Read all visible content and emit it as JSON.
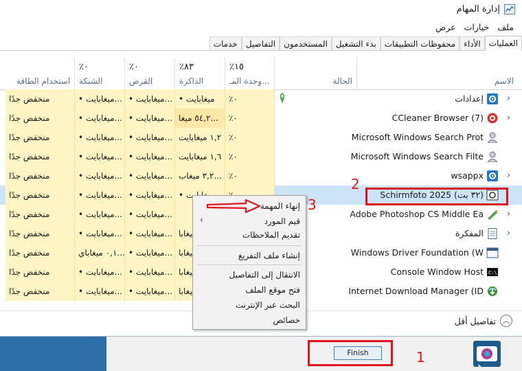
{
  "window": {
    "title": "إدارة المهام",
    "menu": [
      "ملف",
      "خيارات",
      "عرض"
    ],
    "tabs": [
      "العمليات",
      "الأداء",
      "محفوظات التطبيقات",
      "بدء التشغيل",
      "المستخدمون",
      "التفاصيل",
      "خدمات"
    ],
    "active_tab": "العمليات"
  },
  "columns": {
    "name": {
      "label": "الاسم"
    },
    "status": {
      "label": "الحالة"
    },
    "cpu": {
      "pct": "٪١٥",
      "label": "وحدة المـ..."
    },
    "memory": {
      "pct": "٪٨٣",
      "label": "الذاكرة"
    },
    "disk": {
      "pct": "٪٠",
      "label": "القرص"
    },
    "network": {
      "pct": "٪٠",
      "label": "الشبكة"
    },
    "power": {
      "label": "استخدام الطاقة"
    }
  },
  "processes": [
    {
      "name": "إعدادات",
      "icon": "gear-icon",
      "expand": true,
      "status_icon": true,
      "cpu": "٪٠",
      "memory": "• ميغابايت",
      "disk": "• ميغابايت...",
      "network": "• ميغابايت...",
      "power": "منخفض جدًا"
    },
    {
      "name": "CCleaner Browser (7)",
      "icon": "ccleaner-icon",
      "expand": true,
      "cpu": "٪٠",
      "memory": "٥٤,٢ ميغا...",
      "disk": "• ميغابايت...",
      "network": "• ميغابايت...",
      "power": "منخفض جدًا"
    },
    {
      "name": "Microsoft Windows Search Prot",
      "icon": "search-user-icon",
      "expand": false,
      "cpu": "٪٠",
      "memory": "١,٢ ميغابايت",
      "disk": "• ميغابايت...",
      "network": "• ميغابايت...",
      "power": "منخفض جدًا"
    },
    {
      "name": "Microsoft Windows Search Filte",
      "icon": "search-user-icon",
      "expand": false,
      "cpu": "٪٠",
      "memory": "١,٦ ميغابايت",
      "disk": "• ميغابايت...",
      "network": "• ميغابايت...",
      "power": "منخفض جدًا"
    },
    {
      "name": "wsappx",
      "icon": "gear-icon",
      "expand": true,
      "cpu": "٪٠",
      "memory": "٣,٢ ميغاب...",
      "disk": "• ميغابايت...",
      "network": "• ميغابايت...",
      "power": "منخفض جدًا"
    },
    {
      "name": "Schirmfoto 2025 (٣٢ بت)",
      "icon": "camera-icon",
      "expand": false,
      "selected": true,
      "cpu": "٪٠",
      "memory": "• ميغابايت",
      "disk": "• ميغابايت...",
      "network": "• ميغابايت...",
      "power": "منخفض جدًا"
    },
    {
      "name": "Adobe Photoshop CS Middle Ea",
      "icon": "photoshop-icon",
      "expand": true,
      "cpu": "",
      "memory": "",
      "disk": "• ميغابايت...",
      "network": "• ميغابايت...",
      "power": "منخفض جدًا"
    },
    {
      "name": "المفكرة",
      "icon": "notepad-icon",
      "expand": true,
      "cpu": "",
      "memory": "١,٢ ميغابا...",
      "disk": "• ميغابايت...",
      "network": "• ميغابايت...",
      "power": "منخفض جدًا"
    },
    {
      "name": "Windows Driver Foundation (W",
      "icon": "window-icon",
      "expand": false,
      "cpu": "",
      "memory": "١,٦ ميغابا...",
      "disk": "• ميغابايت...",
      "network": "٠,١ ميغاباي...",
      "power": "منخفض جدًا"
    },
    {
      "name": "Console Window Host",
      "icon": "console-icon",
      "expand": false,
      "cpu": "",
      "memory": "١,٦ ميغابا...",
      "disk": "• ميغابايت...",
      "network": "• ميغابايت...",
      "power": "منخفض جدًا"
    },
    {
      "name": "Internet Download Manager (ID",
      "icon": "idm-icon",
      "expand": false,
      "cpu": "",
      "memory": "١,٦ ميغابا...",
      "disk": "• ميغابايت...",
      "network": "• ميغابايت...",
      "power": "منخفض جدًا"
    }
  ],
  "context_menu": {
    "items": [
      "إنهاء المهمة",
      "قيم المورد",
      "تقديم الملاحظات",
      "إنشاء ملف التفريغ",
      "الانتقال إلى التفاصيل",
      "فتح موقع الملف",
      "البحث عبر الإنترنت",
      "خصائص"
    ]
  },
  "footer": {
    "fewer_details": "تفاصيل أقل"
  },
  "finish_button": "Finish",
  "annotations": [
    "1",
    "2",
    "3"
  ],
  "colors": {
    "accent": "#e0141e",
    "selected_row": "#cce4f7",
    "heat_low": "#fff4c3"
  }
}
